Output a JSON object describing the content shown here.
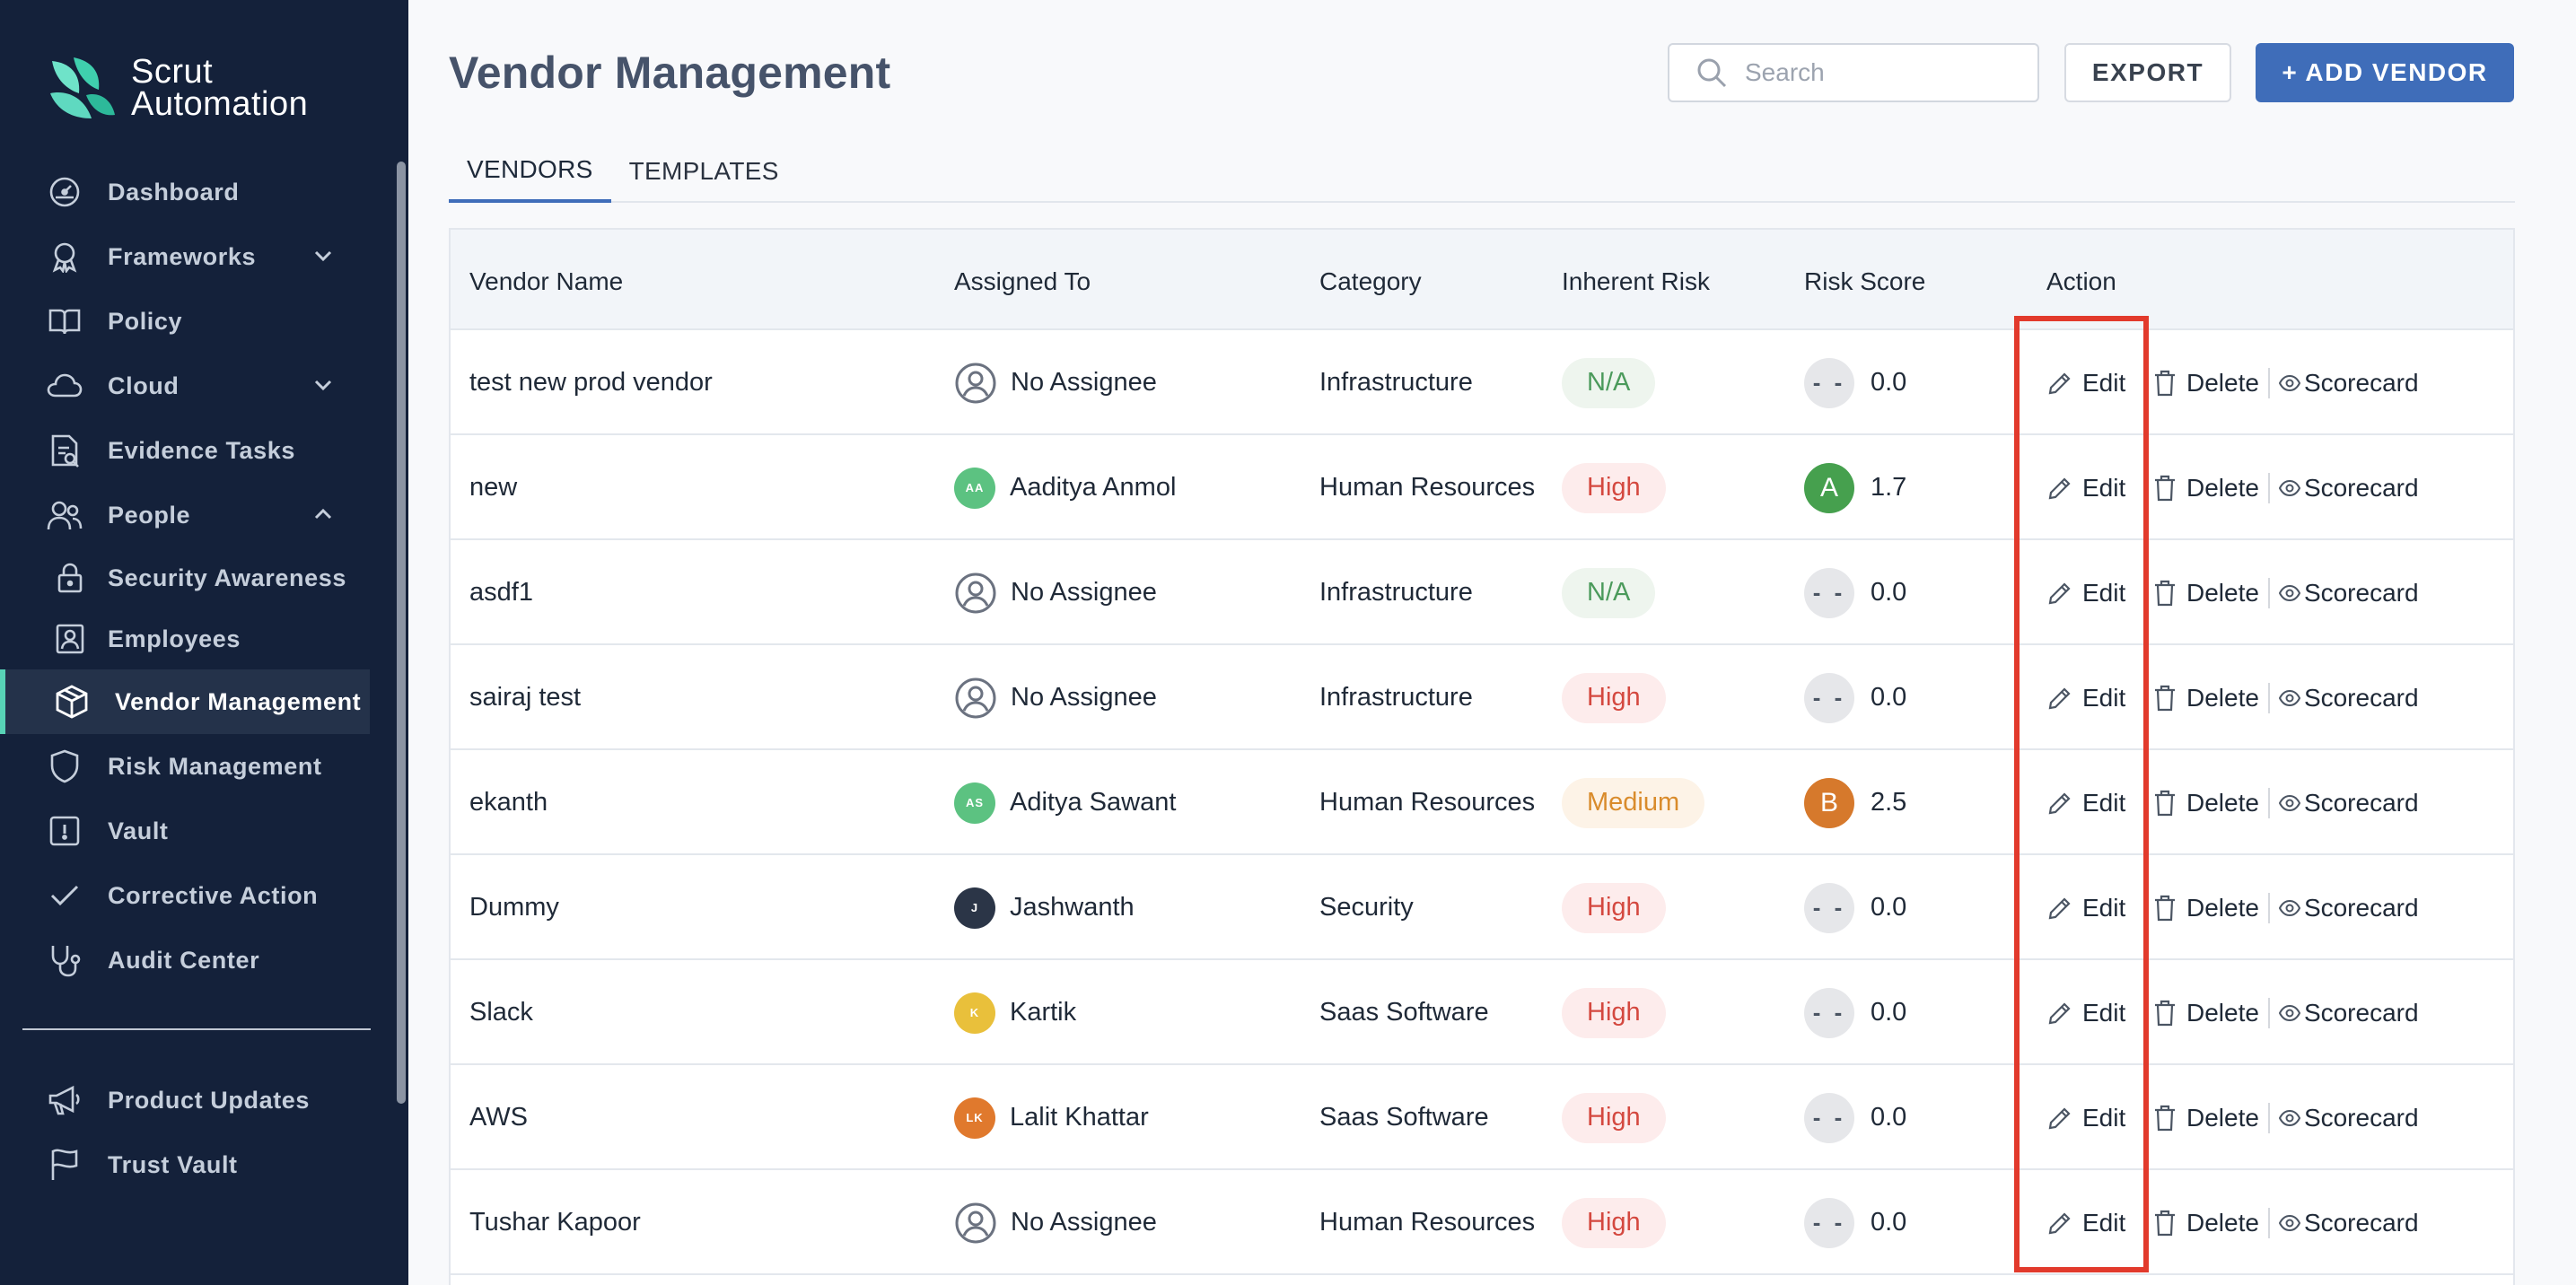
{
  "app": {
    "brand_line1": "Scrut",
    "brand_line2": "Automation"
  },
  "sidebar": {
    "items": [
      {
        "label": "Dashboard",
        "icon": "dashboard-icon"
      },
      {
        "label": "Frameworks",
        "icon": "award-icon",
        "expandable": "collapsed"
      },
      {
        "label": "Policy",
        "icon": "book-icon"
      },
      {
        "label": "Cloud",
        "icon": "cloud-icon",
        "expandable": "collapsed"
      },
      {
        "label": "Evidence Tasks",
        "icon": "evidence-icon"
      },
      {
        "label": "People",
        "icon": "people-icon",
        "expandable": "expanded"
      },
      {
        "label": "Security Awareness",
        "icon": "lock-icon"
      },
      {
        "label": "Employees",
        "icon": "badge-icon"
      },
      {
        "label": "Vendor Management",
        "icon": "cube-icon",
        "active": true
      },
      {
        "label": "Risk Management",
        "icon": "shield-icon"
      },
      {
        "label": "Vault",
        "icon": "vault-icon"
      },
      {
        "label": "Corrective Action",
        "icon": "check-icon"
      },
      {
        "label": "Audit Center",
        "icon": "stethoscope-icon"
      }
    ],
    "bottom_items": [
      {
        "label": "Product Updates",
        "icon": "megaphone-icon"
      },
      {
        "label": "Trust Vault",
        "icon": "flag-icon"
      }
    ]
  },
  "header": {
    "title": "Vendor Management",
    "search_placeholder": "Search",
    "export_label": "EXPORT",
    "add_label": "+ ADD VENDOR"
  },
  "tabs": [
    {
      "label": "VENDORS",
      "active": true
    },
    {
      "label": "TEMPLATES",
      "active": false
    }
  ],
  "table": {
    "columns": [
      "Vendor Name",
      "Assigned To",
      "Category",
      "Inherent Risk",
      "Risk Score",
      "Action"
    ],
    "actions": {
      "edit": "Edit",
      "delete": "Delete",
      "scorecard": "Scorecard"
    },
    "rows": [
      {
        "name": "test new prod vendor",
        "assignee": "No Assignee",
        "initials": "",
        "avatar_color": "",
        "category": "Infrastructure",
        "risk": "N/A",
        "risk_level": "na",
        "grade": "- -",
        "score": "0.0"
      },
      {
        "name": "new",
        "assignee": "Aaditya Anmol",
        "initials": "AA",
        "avatar_color": "#5cc281",
        "category": "Human Resources",
        "risk": "High",
        "risk_level": "high",
        "grade": "A",
        "score": "1.7"
      },
      {
        "name": "asdf1",
        "assignee": "No Assignee",
        "initials": "",
        "avatar_color": "",
        "category": "Infrastructure",
        "risk": "N/A",
        "risk_level": "na",
        "grade": "- -",
        "score": "0.0"
      },
      {
        "name": "sairaj test",
        "assignee": "No Assignee",
        "initials": "",
        "avatar_color": "",
        "category": "Infrastructure",
        "risk": "High",
        "risk_level": "high",
        "grade": "- -",
        "score": "0.0"
      },
      {
        "name": "ekanth",
        "assignee": "Aditya Sawant",
        "initials": "AS",
        "avatar_color": "#5cc281",
        "category": "Human Resources",
        "risk": "Medium",
        "risk_level": "medium",
        "grade": "B",
        "score": "2.5"
      },
      {
        "name": "Dummy",
        "assignee": "Jashwanth",
        "initials": "J",
        "avatar_color": "#2b3547",
        "category": "Security",
        "risk": "High",
        "risk_level": "high",
        "grade": "- -",
        "score": "0.0"
      },
      {
        "name": "Slack",
        "assignee": "Kartik",
        "initials": "K",
        "avatar_color": "#e9c03b",
        "category": "Saas Software",
        "risk": "High",
        "risk_level": "high",
        "grade": "- -",
        "score": "0.0"
      },
      {
        "name": "AWS",
        "assignee": "Lalit Khattar",
        "initials": "LK",
        "avatar_color": "#e0792d",
        "category": "Saas Software",
        "risk": "High",
        "risk_level": "high",
        "grade": "- -",
        "score": "0.0"
      },
      {
        "name": "Tushar Kapoor",
        "assignee": "No Assignee",
        "initials": "",
        "avatar_color": "",
        "category": "Human Resources",
        "risk": "High",
        "risk_level": "high",
        "grade": "- -",
        "score": "0.0"
      }
    ]
  },
  "colors": {
    "sidebar_bg": "#14213a",
    "accent": "#58d3b6",
    "primary": "#3f6db9",
    "highlight": "#e23a2c"
  }
}
